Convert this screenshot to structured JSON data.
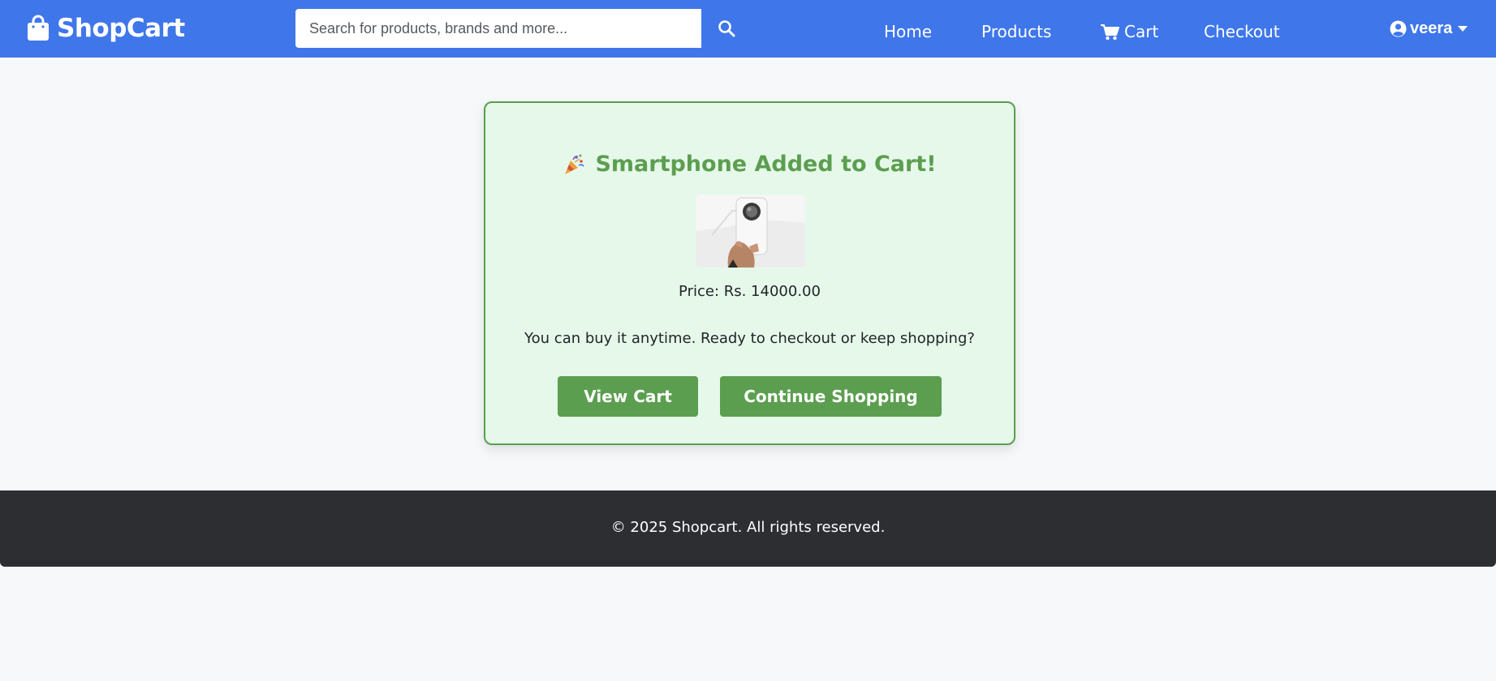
{
  "navbar": {
    "brand": {
      "name": "ShopCart",
      "icon": "shopping-bag-icon"
    },
    "search": {
      "placeholder": "Search for products, brands and more...",
      "value": "",
      "icon": "search-icon"
    },
    "links": [
      {
        "label": "Home"
      },
      {
        "label": "Products"
      },
      {
        "label": "Cart",
        "icon": "cart-icon"
      },
      {
        "label": "Checkout"
      }
    ],
    "user": {
      "name": "veera",
      "icon": "user-circle-icon",
      "caret_icon": "caret-down-icon"
    },
    "colors": {
      "background": "#3f76ea",
      "text": "#ffffff"
    }
  },
  "card": {
    "title_icon": "party-popper-icon",
    "title": "Smartphone Added to Cart!",
    "product_image": "smartphone-image",
    "price": "Price: Rs. 14000.00",
    "message": "You can buy it anytime. Ready to checkout or keep shopping?",
    "buttons": {
      "view_cart": "View Cart",
      "continue_shopping": "Continue Shopping"
    },
    "colors": {
      "background": "#e6f8ea",
      "border": "#5a9e4f",
      "accent": "#5c9e50"
    }
  },
  "footer": {
    "text": "© 2025 Shopcart. All rights reserved.",
    "colors": {
      "background": "#2d2e32",
      "text": "#ffffff"
    }
  }
}
